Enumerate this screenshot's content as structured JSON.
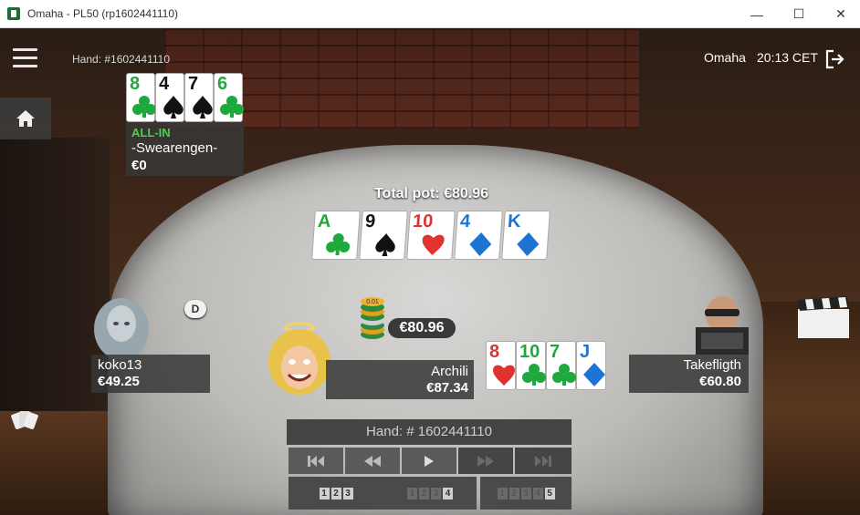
{
  "window": {
    "title": "Omaha - PL50 (rp1602441110)",
    "minimize_glyph": "—",
    "maximize_glyph": "☐",
    "close_glyph": "✕"
  },
  "header": {
    "hand_label": "Hand: #1602441110",
    "game_type": "Omaha",
    "time": "20:13 CET"
  },
  "pot": {
    "total": "Total pot: €80.96",
    "bet": "€80.96"
  },
  "board": [
    {
      "rank": "A",
      "suit": "clubs",
      "color": "#1fa83c"
    },
    {
      "rank": "9",
      "suit": "spades",
      "color": "#111111"
    },
    {
      "rank": "10",
      "suit": "hearts",
      "color": "#e0322f"
    },
    {
      "rank": "4",
      "suit": "diamonds",
      "color": "#1e74d4"
    },
    {
      "rank": "K",
      "suit": "diamonds",
      "color": "#1e74d4"
    }
  ],
  "players": {
    "swearengen": {
      "status": "ALL-IN",
      "name": "-Swearengen-",
      "stack": "€0",
      "cards": [
        {
          "rank": "8",
          "suit": "clubs",
          "color": "#1fa83c"
        },
        {
          "rank": "4",
          "suit": "spades",
          "color": "#111111"
        },
        {
          "rank": "7",
          "suit": "spades",
          "color": "#111111"
        },
        {
          "rank": "6",
          "suit": "clubs",
          "color": "#1fa83c"
        }
      ]
    },
    "koko13": {
      "name": "koko13",
      "stack": "€49.25"
    },
    "archili": {
      "name": "Archili",
      "stack": "€87.34",
      "cards": [
        {
          "rank": "8",
          "suit": "hearts",
          "color": "#e0322f"
        },
        {
          "rank": "10",
          "suit": "clubs",
          "color": "#1fa83c"
        },
        {
          "rank": "7",
          "suit": "clubs",
          "color": "#1fa83c"
        },
        {
          "rank": "J",
          "suit": "diamonds",
          "color": "#1e74d4"
        }
      ]
    },
    "takefligth": {
      "name": "Takefligth",
      "stack": "€60.80"
    }
  },
  "dealer_button": "D",
  "chip_label": "0.01",
  "replay": {
    "hand_label": "Hand: # 1602441110",
    "controls": [
      "first-icon",
      "rewind-icon",
      "play-icon",
      "forward-icon",
      "last-icon"
    ],
    "speeds": [
      {
        "digits": [
          "1",
          "2",
          "3"
        ],
        "active": [
          true,
          true,
          true
        ]
      },
      {
        "digits": [
          "1",
          "2",
          "3",
          "4"
        ],
        "active": [
          false,
          false,
          false,
          true
        ]
      },
      {
        "digits": [
          "1",
          "2",
          "3",
          "4",
          "5"
        ],
        "active": [
          false,
          false,
          false,
          false,
          true
        ]
      }
    ]
  },
  "colors": {
    "allin": "#4cd14c",
    "panel": "#373737"
  }
}
